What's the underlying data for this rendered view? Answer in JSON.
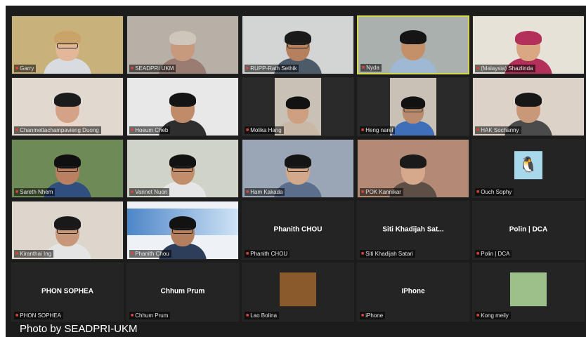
{
  "tiles": [
    {
      "name": "Garry",
      "bg": "#c9b27a",
      "skin": "#e2b79a",
      "hair": "#caa36b",
      "shirt": "#d8dce0",
      "glasses": true,
      "video": true
    },
    {
      "name": "SEADPRI UKM",
      "bg": "#b7b0a6",
      "skin": "#c79a7e",
      "hair": "#cfc6bb",
      "shirt": "#9a7c73",
      "glasses": false,
      "video": true
    },
    {
      "name": "RUPP-Rath Sethik",
      "bg": "#d3d4d4",
      "skin": "#b5805d",
      "hair": "#1a1a1a",
      "shirt": "#4d5a68",
      "glasses": true,
      "video": true
    },
    {
      "name": "Nyda",
      "bg": "#a9b0ad",
      "skin": "#c4906a",
      "hair": "#151515",
      "shirt": "#9fb8d4",
      "glasses": false,
      "video": true,
      "active": true
    },
    {
      "name": "(Malaysia) Shazlinda",
      "bg": "#e6e2d8",
      "skin": "#d9a882",
      "hair": "#b3305a",
      "shirt": "#b3305a",
      "glasses": false,
      "video": true
    },
    {
      "name": "Chanmettachampavieng Duong",
      "bg": "#e1d8cf",
      "skin": "#d4a284",
      "hair": "#1b1b1b",
      "shirt": "#e9d7cc",
      "glasses": false,
      "video": true
    },
    {
      "name": "Hoeum Cheb",
      "bg": "#e8e8e8",
      "skin": "#bf8b69",
      "hair": "#141414",
      "shirt": "#2e2e2e",
      "glasses": false,
      "video": true
    },
    {
      "name": "Molika Hang",
      "bg": "#2a2a2a",
      "skin": "#cf9f82",
      "hair": "#121212",
      "shirt": "#c9b8a5",
      "glasses": false,
      "video": true,
      "small": true
    },
    {
      "name": "Heng narel",
      "bg": "#2a2a2a",
      "skin": "#b98a6b",
      "hair": "#111111",
      "shirt": "#3f6fb8",
      "glasses": true,
      "video": true,
      "small": true
    },
    {
      "name": "HAK Sochanny",
      "bg": "#dcd2c8",
      "skin": "#c89879",
      "hair": "#171717",
      "shirt": "#4b4b4b",
      "glasses": false,
      "video": true
    },
    {
      "name": "Sareth Nhem",
      "bg": "#6e8a56",
      "skin": "#b98062",
      "hair": "#101010",
      "shirt": "#304f7f",
      "glasses": true,
      "video": true
    },
    {
      "name": "Vannet Nuon",
      "bg": "#d0d3c8",
      "skin": "#c28d6b",
      "hair": "#121212",
      "shirt": "#e6e6e6",
      "glasses": true,
      "video": true
    },
    {
      "name": "Ham Kakada",
      "bg": "#9aa6b6",
      "skin": "#d4a88a",
      "hair": "#151515",
      "shirt": "#5b6e8b",
      "glasses": true,
      "video": true
    },
    {
      "name": "POK Kannikar",
      "bg": "#b28a76",
      "skin": "#d7a98c",
      "hair": "#1a1a1a",
      "shirt": "#5d4f46",
      "glasses": false,
      "video": true
    },
    {
      "name": "Ouch Sophy",
      "bg": "#242424",
      "video": false,
      "avatar": true
    },
    {
      "name": "Kiranthai Ing",
      "bg": "#ddd6cc",
      "skin": "#c8977a",
      "hair": "#191919",
      "shirt": "#e4e4e4",
      "glasses": true,
      "video": true
    },
    {
      "name": "Phanith Chou",
      "bg": "#eef1f5",
      "skin": "#b47f5f",
      "hair": "#121212",
      "shirt": "#2c3e5a",
      "glasses": true,
      "video": true,
      "slide": true
    },
    {
      "name": "Phanith CHOU",
      "display": "Phanith CHOU",
      "bg": "#242424",
      "video": false
    },
    {
      "name": "Siti Khadijah Satari",
      "display": "Siti Khadijah Sat...",
      "bg": "#242424",
      "video": false
    },
    {
      "name": "Polin | DCA",
      "display": "Polin | DCA",
      "bg": "#242424",
      "video": false
    },
    {
      "name": "PHON SOPHEA",
      "display": "PHON SOPHEA",
      "bg": "#242424",
      "video": false
    },
    {
      "name": "Chhum Prum",
      "display": "Chhum Prum",
      "bg": "#242424",
      "video": false
    },
    {
      "name": "Lao Bolina",
      "bg": "#242424",
      "video": false,
      "thumb": "#8a5a2a"
    },
    {
      "name": "iPhone",
      "display": "iPhone",
      "bg": "#242424",
      "video": false
    },
    {
      "name": "Kong meily",
      "bg": "#242424",
      "video": false,
      "thumb": "#9bc08a"
    }
  ],
  "credit": "Photo by SEADPRI-UKM",
  "icons": {
    "muted": "mic-muted-icon"
  }
}
